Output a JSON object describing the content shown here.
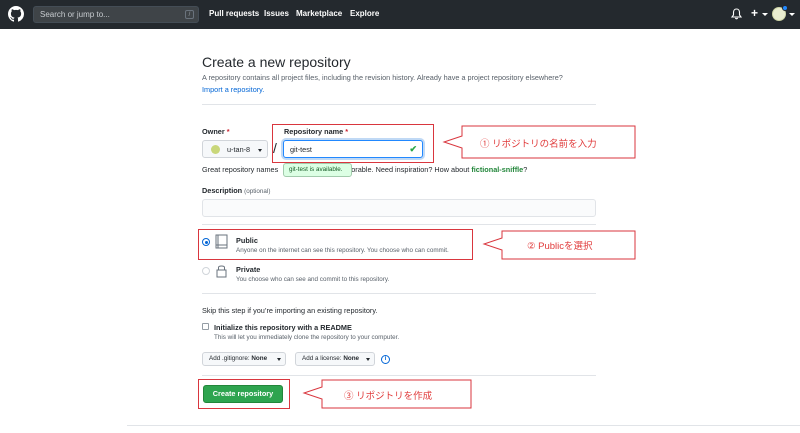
{
  "header": {
    "search_placeholder": "Search or jump to...",
    "slash_key": "/",
    "nav": [
      "Pull requests",
      "Issues",
      "Marketplace",
      "Explore"
    ]
  },
  "page": {
    "title": "Create a new repository",
    "subtitle": "A repository contains all project files, including the revision history. Already have a project repository elsewhere?",
    "import_link": "Import a repository."
  },
  "form": {
    "owner_label": "Owner",
    "required_mark": "*",
    "owner_value": "u-tan-8",
    "repo_name_label": "Repository name",
    "repo_name_value": "git-test",
    "separator": "/",
    "availability_tooltip": "git-test is available.",
    "great_prefix": "Great repository names",
    "great_middle": "orable. Need inspiration? How about",
    "suggestion": "fictional-sniffle",
    "suggestion_suffix": "?",
    "description_label": "Description",
    "description_optional": "(optional)",
    "description_value": "",
    "visibility": {
      "selected": "public",
      "public_title": "Public",
      "public_desc": "Anyone on the internet can see this repository. You choose who can commit.",
      "private_title": "Private",
      "private_desc": "You choose who can see and commit to this repository."
    },
    "skip_text": "Skip this step if you’re importing an existing repository.",
    "readme_title": "Initialize this repository with a README",
    "readme_desc": "This will let you immediately clone the repository to your computer.",
    "readme_checked": false,
    "gitignore_label": "Add .gitignore:",
    "gitignore_value": "None",
    "license_label": "Add a license:",
    "license_value": "None",
    "info_glyph": "i",
    "create_button": "Create repository"
  },
  "annotations": {
    "step1": "① リポジトリの名前を入力",
    "step2": "② Publicを選択",
    "step3": "③ リポジトリを作成",
    "color": "#e03a3a"
  },
  "colors": {
    "header_bg": "#24292e",
    "primary_button": "#2ea44f",
    "link": "#0366d6",
    "success_green": "#28a745"
  }
}
